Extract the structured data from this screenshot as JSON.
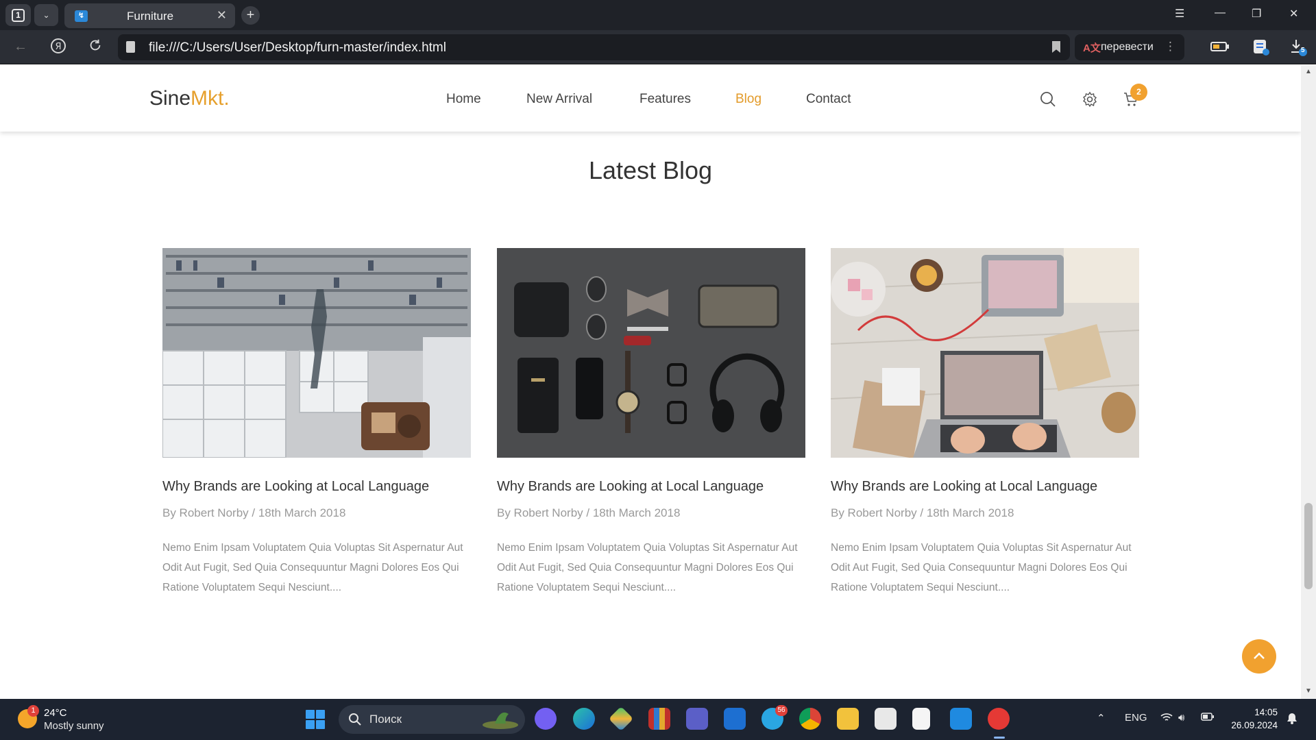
{
  "browser": {
    "tab_count": "1",
    "tab_title": "Furniture",
    "url": "file:///C:/Users/User/Desktop/furn-master/index.html",
    "translate_label": "перевести",
    "downloads_count": "5"
  },
  "site": {
    "logo_main": "Sine",
    "logo_accent": "Mkt",
    "logo_dot": ".",
    "nav": [
      {
        "label": "Home"
      },
      {
        "label": "New Arrival"
      },
      {
        "label": "Features"
      },
      {
        "label": "Blog",
        "active": true
      },
      {
        "label": "Contact"
      }
    ],
    "cart_count": "2",
    "accent_color": "#e39b2a"
  },
  "blog": {
    "section_title": "Latest Blog",
    "posts": [
      {
        "title": "Why Brands are Looking at Local Language",
        "meta": "By Robert Norby / 18th March 2018",
        "excerpt": "Nemo Enim Ipsam Voluptatem Quia Voluptas Sit Aspernatur Aut Odit Aut Fugit, Sed Quia Consequuntur Magni Dolores Eos Qui Ratione Voluptatem Sequi Nesciunt....",
        "image": "shop-interior"
      },
      {
        "title": "Why Brands are Looking at Local Language",
        "meta": "By Robert Norby / 18th March 2018",
        "excerpt": "Nemo Enim Ipsam Voluptatem Quia Voluptas Sit Aspernatur Aut Odit Aut Fugit, Sed Quia Consequuntur Magni Dolores Eos Qui Ratione Voluptatem Sequi Nesciunt....",
        "image": "accessories-flatlay"
      },
      {
        "title": "Why Brands are Looking at Local Language",
        "meta": "By Robert Norby / 18th March 2018",
        "excerpt": "Nemo Enim Ipsam Voluptatem Quia Voluptas Sit Aspernatur Aut Odit Aut Fugit, Sed Quia Consequuntur Magni Dolores Eos Qui Ratione Voluptatem Sequi Nesciunt....",
        "image": "desk-laptop"
      }
    ]
  },
  "taskbar": {
    "weather_temp": "24°C",
    "weather_cond": "Mostly sunny",
    "weather_badge": "1",
    "search_label": "Поиск",
    "telegram_badge": "56",
    "lang": "ENG",
    "time": "14:05",
    "date": "26.09.2024"
  }
}
